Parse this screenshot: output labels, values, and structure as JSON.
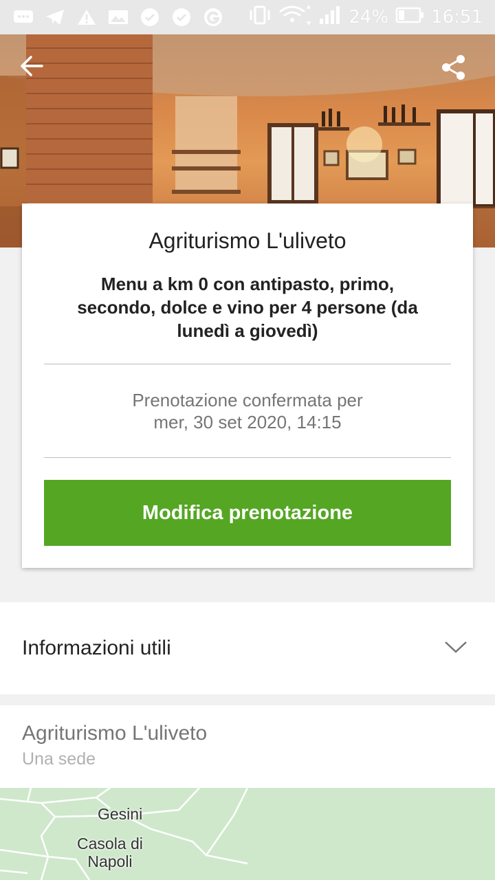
{
  "status_bar": {
    "battery_percent": "24%",
    "time": "16:51",
    "left_icons": [
      "message-icon",
      "telegram-icon",
      "warning-icon",
      "gallery-icon",
      "check-icon",
      "check-icon",
      "google-icon"
    ]
  },
  "hero": {
    "back_icon": "arrow-back-icon",
    "share_icon": "share-icon"
  },
  "booking": {
    "restaurant": "Agriturismo L'uliveto",
    "offer": "Menu a km 0 con antipasto, primo, secondo, dolce e vino per 4 persone (da lunedì a giovedì)",
    "confirmation_line1": "Prenotazione confermata per",
    "confirmation_line2": "mer, 30 set 2020, 14:15",
    "modify_button": "Modifica prenotazione"
  },
  "info": {
    "label": "Informazioni utili"
  },
  "location": {
    "name": "Agriturismo L'uliveto",
    "subtitle": "Una sede"
  },
  "map": {
    "place1": "Gesini",
    "place2_line1": "Casola di",
    "place2_line2": "Napoli"
  },
  "colors": {
    "primary_button": "#55a623",
    "map_green": "#cfe8cc"
  }
}
